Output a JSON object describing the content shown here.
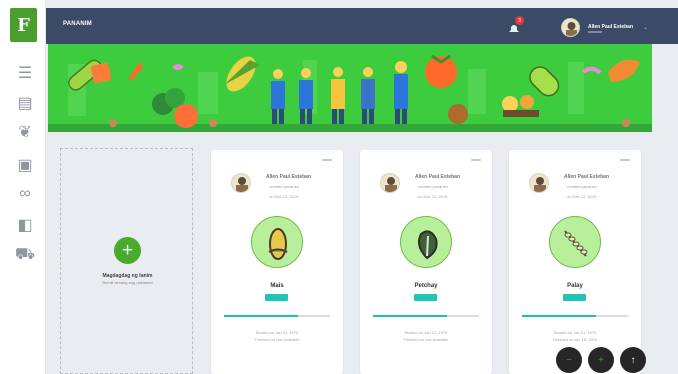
{
  "app": {
    "logo_text": "F",
    "title": "PANANIM"
  },
  "sidebar": {
    "items": [
      {
        "icon": "list-icon",
        "glyph": "☰"
      },
      {
        "icon": "document-icon",
        "glyph": "▤"
      },
      {
        "icon": "leaf-icon",
        "glyph": "❦"
      },
      {
        "icon": "clipboard-icon",
        "glyph": "▣"
      },
      {
        "icon": "link-icon",
        "glyph": "∞"
      },
      {
        "icon": "panel-icon",
        "glyph": "◧"
      },
      {
        "icon": "cart-icon",
        "glyph": "⛟"
      }
    ]
  },
  "header": {
    "notification_count": "3",
    "user_name": "Allen Paul Esteban",
    "colors": {
      "bar": "#3b4a66",
      "banner": "#39c93a"
    }
  },
  "add_card": {
    "plus": "+",
    "title": "Magdagdag ng tanim",
    "subtitle": "Bumili lamang ang dokiment"
  },
  "cards": [
    {
      "author": "Allen Paul Esteban",
      "action": "created pananim",
      "date": "on Dec 12, 2019",
      "crop": "Mais",
      "icon": "corn-icon",
      "badge": "",
      "progress": 0.7,
      "started": "Started on Jan 01, 1970",
      "finished": "Finished on Not Available"
    },
    {
      "author": "Allen Paul Esteban",
      "action": "created pananim",
      "date": "on Dec 12, 2019",
      "crop": "Petchay",
      "icon": "pechay-icon",
      "badge": "",
      "progress": 0.7,
      "started": "Started on Jan 01, 1970",
      "finished": "Finished on Not Available"
    },
    {
      "author": "Allen Paul Esteban",
      "action": "created pananim",
      "date": "on Dec 12, 2019",
      "crop": "Palay",
      "icon": "rice-icon",
      "badge": "",
      "progress": 0.7,
      "started": "Started on Jan 01, 1970",
      "finished": "Finished on Apr 18, 2019"
    }
  ],
  "fabs": [
    {
      "icon": "minus-icon",
      "glyph": "−",
      "color": "#3f9f2f"
    },
    {
      "icon": "plus-icon",
      "glyph": "+",
      "color": "#3f9f2f"
    },
    {
      "icon": "arrow-up-icon",
      "glyph": "↑",
      "color": "#ffffff"
    }
  ]
}
